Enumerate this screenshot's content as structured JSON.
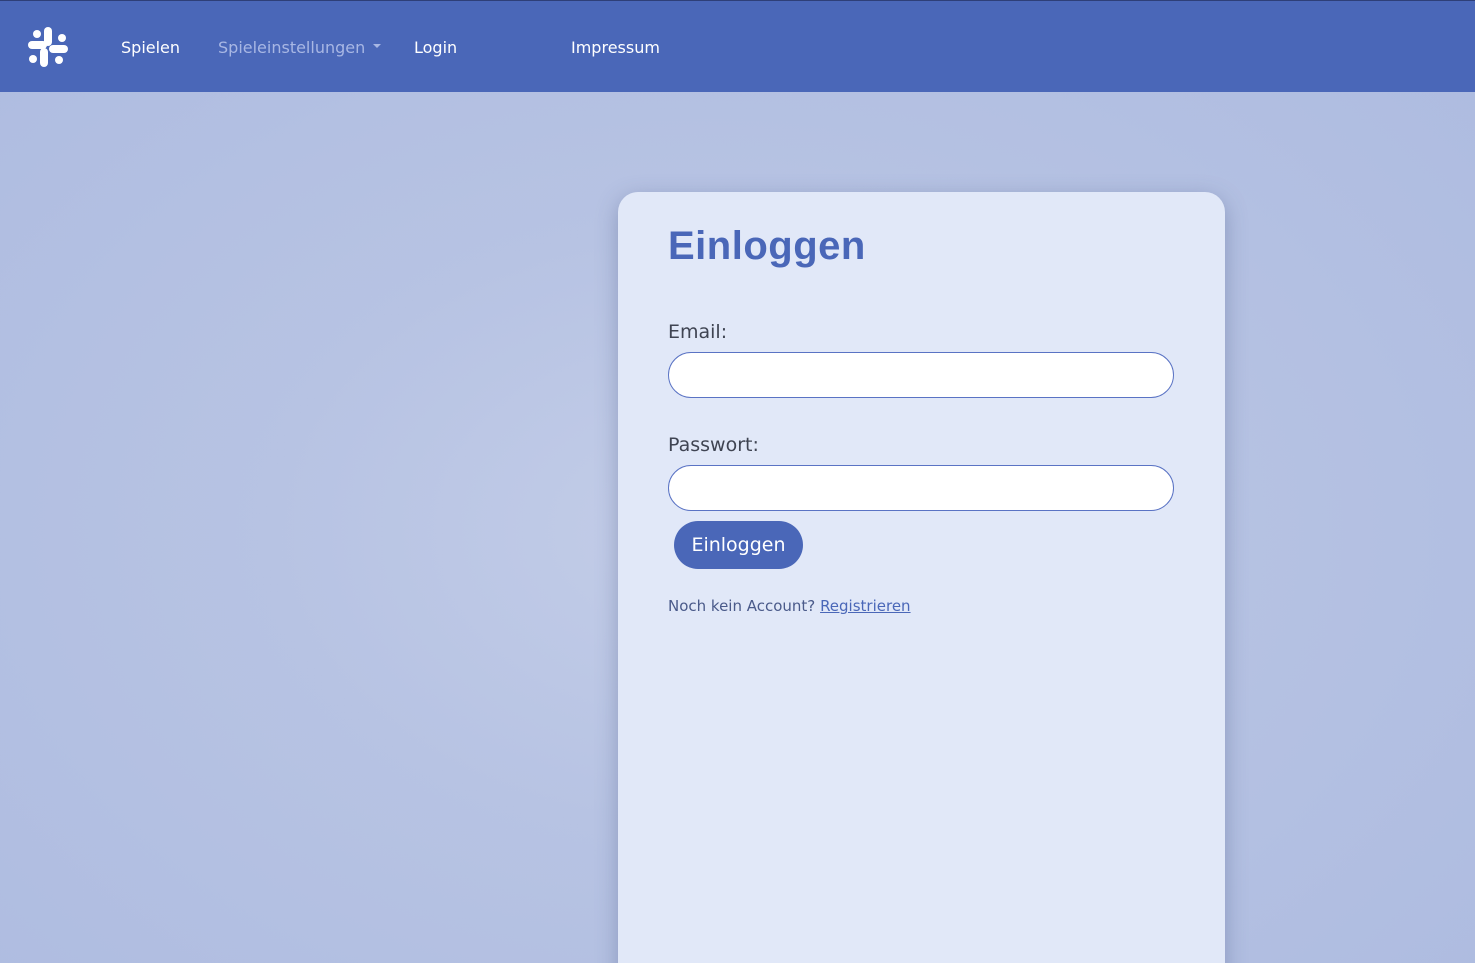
{
  "navbar": {
    "logo_icon": "slack-logo-icon",
    "links": {
      "play": "Spielen",
      "game_settings": "Spieleinstellungen",
      "login": "Login",
      "imprint": "Impressum"
    }
  },
  "login_card": {
    "title": "Einloggen",
    "email_label": "Email:",
    "email_value": "",
    "password_label": "Passwort:",
    "password_value": "",
    "submit_label": "Einloggen",
    "register_prompt": "Noch kein Account?",
    "register_link": "Registrieren"
  },
  "colors": {
    "accent": "#4a67b8",
    "background": "#b7c3e3",
    "card_background": "#e1e8f8"
  }
}
